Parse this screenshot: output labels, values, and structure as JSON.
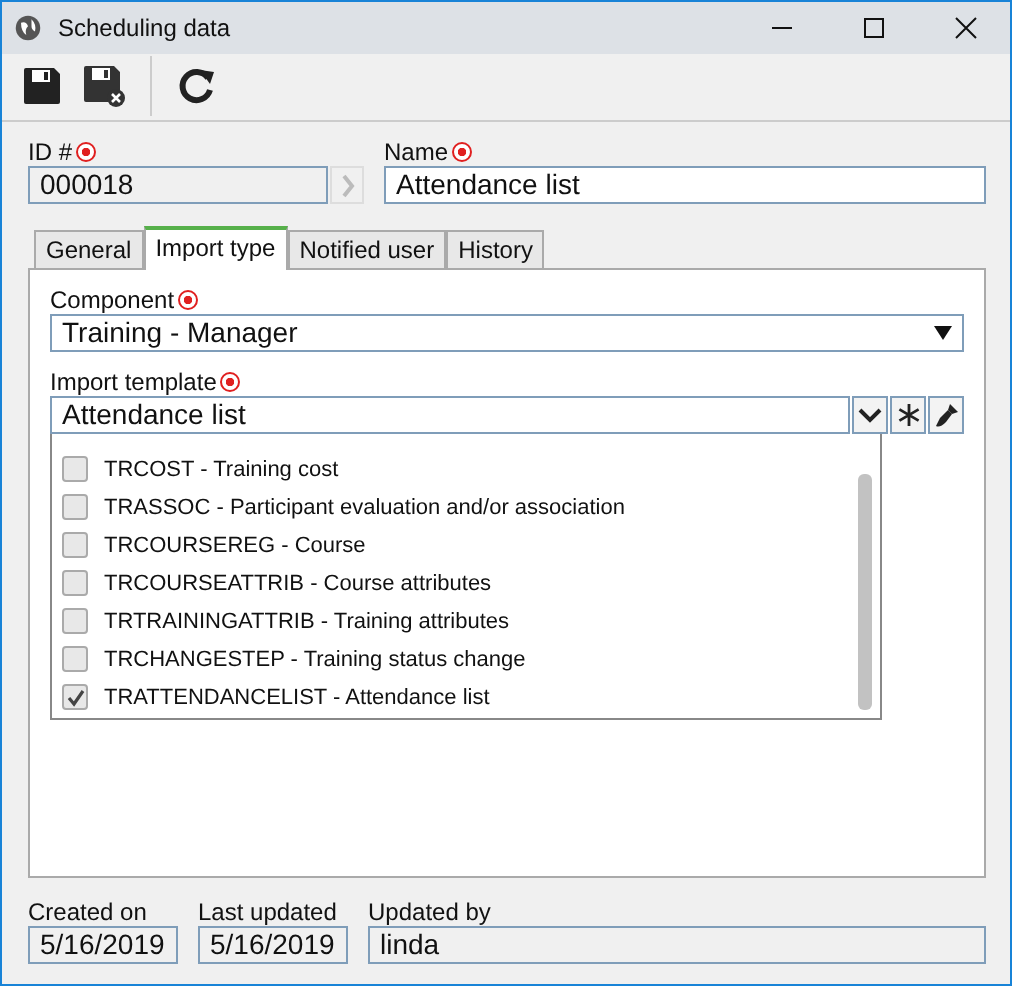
{
  "window": {
    "title": "Scheduling data"
  },
  "id_field": {
    "label": "ID #",
    "required": true,
    "value": "000018"
  },
  "name_field": {
    "label": "Name",
    "required": true,
    "value": "Attendance list"
  },
  "tabs": [
    {
      "label": "General",
      "selected": false
    },
    {
      "label": "Import type",
      "selected": true
    },
    {
      "label": "Notified user",
      "selected": false
    },
    {
      "label": "History",
      "selected": false
    }
  ],
  "component": {
    "label": "Component",
    "required": true,
    "value": "Training - Manager"
  },
  "import_template": {
    "label": "Import template",
    "required": true,
    "value": "Attendance list",
    "options": [
      {
        "label": "TRCOST - Training cost",
        "checked": false
      },
      {
        "label": "TRASSOC - Participant evaluation and/or association",
        "checked": false
      },
      {
        "label": "TRCOURSEREG - Course",
        "checked": false
      },
      {
        "label": "TRCOURSEATTRIB - Course attributes",
        "checked": false
      },
      {
        "label": "TRTRAININGATTRIB - Training attributes",
        "checked": false
      },
      {
        "label": "TRCHANGESTEP - Training status change",
        "checked": false
      },
      {
        "label": "TRATTENDANCELIST - Attendance list",
        "checked": true
      }
    ]
  },
  "footer": [
    {
      "label": "Created on",
      "value": "5/16/2019"
    },
    {
      "label": "Last updated",
      "value": "5/16/2019"
    },
    {
      "label": "Updated by",
      "value": "linda"
    }
  ]
}
